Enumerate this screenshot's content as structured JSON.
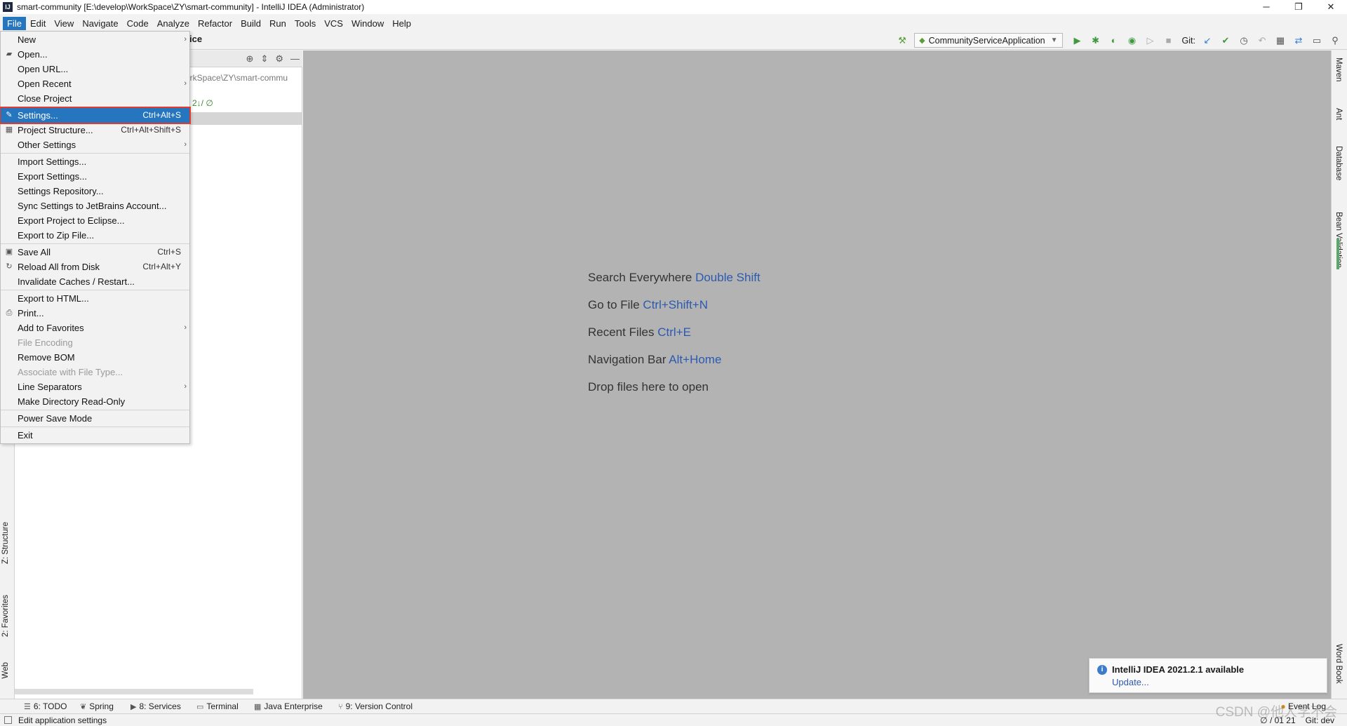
{
  "window": {
    "title": "smart-community [E:\\develop\\WorkSpace\\ZY\\smart-community] - IntelliJ IDEA (Administrator)",
    "app_icon_text": "IJ",
    "minimize": "─",
    "restore": "❐",
    "close": "✕"
  },
  "menubar": [
    "File",
    "Edit",
    "View",
    "Navigate",
    "Code",
    "Analyze",
    "Refactor",
    "Build",
    "Run",
    "Tools",
    "VCS",
    "Window",
    "Help"
  ],
  "toolbar": {
    "breadcrumb_tail": "ice",
    "run_config": "CommunityServiceApplication",
    "git_label": "Git:"
  },
  "project_panel": {
    "path": "orkSpace\\ZY\\smart-commu",
    "branch": "2↓/ ∅"
  },
  "file_menu": {
    "items": [
      {
        "label": "New",
        "submenu": true
      },
      {
        "label": "Open...",
        "icon": "folder-icon"
      },
      {
        "label": "Open URL..."
      },
      {
        "label": "Open Recent",
        "submenu": true
      },
      {
        "label": "Close Project",
        "sep_after": true
      },
      {
        "label": "Settings...",
        "shortcut": "Ctrl+Alt+S",
        "icon": "wrench-icon",
        "highlight": true
      },
      {
        "label": "Project Structure...",
        "shortcut": "Ctrl+Alt+Shift+S",
        "icon": "structure-icon"
      },
      {
        "label": "Other Settings",
        "submenu": true,
        "sep_after": true
      },
      {
        "label": "Import Settings..."
      },
      {
        "label": "Export Settings..."
      },
      {
        "label": "Settings Repository..."
      },
      {
        "label": "Sync Settings to JetBrains Account..."
      },
      {
        "label": "Export Project to Eclipse..."
      },
      {
        "label": "Export to Zip File...",
        "sep_after": true
      },
      {
        "label": "Save All",
        "shortcut": "Ctrl+S",
        "icon": "save-icon"
      },
      {
        "label": "Reload All from Disk",
        "shortcut": "Ctrl+Alt+Y",
        "icon": "reload-icon"
      },
      {
        "label": "Invalidate Caches / Restart...",
        "sep_after": true
      },
      {
        "label": "Export to HTML..."
      },
      {
        "label": "Print...",
        "icon": "print-icon"
      },
      {
        "label": "Add to Favorites",
        "submenu": true
      },
      {
        "label": "File Encoding",
        "disabled": true
      },
      {
        "label": "Remove BOM"
      },
      {
        "label": "Associate with File Type...",
        "disabled": true
      },
      {
        "label": "Line Separators",
        "submenu": true
      },
      {
        "label": "Make Directory Read-Only",
        "sep_after": true
      },
      {
        "label": "Power Save Mode",
        "sep_after": true
      },
      {
        "label": "Exit"
      }
    ]
  },
  "editor_hints": [
    {
      "text": "Search Everywhere ",
      "key": "Double Shift"
    },
    {
      "text": "Go to File ",
      "key": "Ctrl+Shift+N"
    },
    {
      "text": "Recent Files ",
      "key": "Ctrl+E"
    },
    {
      "text": "Navigation Bar ",
      "key": "Alt+Home"
    },
    {
      "text": "Drop files here to open",
      "key": ""
    }
  ],
  "left_tabs": [
    "2: Favorites",
    "Z: Structure",
    "Web"
  ],
  "right_tabs": [
    "Maven",
    "Ant",
    "Database",
    "Bean Validation",
    "Word Book"
  ],
  "notification": {
    "title": "IntelliJ IDEA 2021.2.1 available",
    "link": "Update..."
  },
  "bottom_tabs": [
    "6: TODO",
    "Spring",
    "8: Services",
    "Terminal",
    "Java Enterprise",
    "9: Version Control"
  ],
  "event_log": "Event Log",
  "status": {
    "text": "Edit application settings",
    "position": "∅ / 01 21",
    "git": "Git: dev"
  },
  "watermark": "CSDN @他人学不会"
}
